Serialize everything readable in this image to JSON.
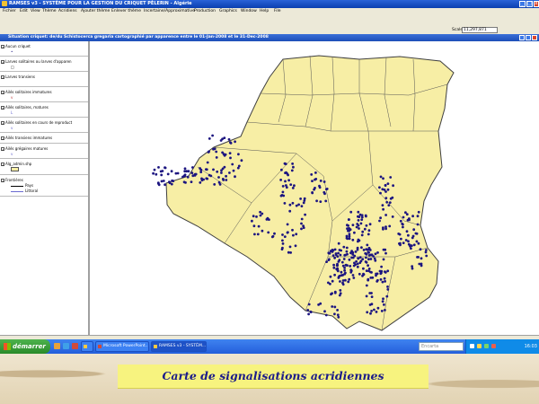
{
  "window": {
    "title": "RAMSES v3 - SYSTÈME POUR LA GESTION DU CRIQUET PÈLERIN - Algérie"
  },
  "menu": [
    "Fichier",
    "Edit",
    "View",
    "Thème",
    "Acridiens",
    "Ajouter thème",
    "Enlever thème",
    "Incertaine/Approximative",
    "Production",
    "Graphics",
    "Window",
    "Help",
    "File"
  ],
  "toolbar": {
    "scale_label": "Scale 1:",
    "scale_value": "11,297,871"
  },
  "view": {
    "title": "Situation criquet: de/du Schistocerca gregaria cartographié par apparence entre le 01-Jan-2008 et le 31-Dec-2008"
  },
  "legend": {
    "layers": [
      {
        "label": "Aucun criquet",
        "checked": true,
        "symbol": "•"
      },
      {
        "label": "Larves solitaires ou larves d'apparen",
        "checked": true,
        "symbol": "□"
      },
      {
        "label": "Larves transiens",
        "checked": true,
        "symbol": ""
      },
      {
        "label": "Ailés solitaires immatures",
        "checked": true,
        "symbol": "v"
      },
      {
        "label": "Ailés solitaires, matures",
        "checked": true,
        "symbol": "L"
      },
      {
        "label": "Ailés solitaires en cours de reproduct",
        "checked": true,
        "symbol": "v"
      },
      {
        "label": "Ailés transiens immatures",
        "checked": true,
        "symbol": ""
      },
      {
        "label": "Ailés grégaires matures",
        "checked": true,
        "symbol": "v"
      },
      {
        "label": "Alg_admin.shp",
        "checked": true,
        "symbol": ""
      },
      {
        "label": "Frontières",
        "checked": true,
        "symbol": ""
      }
    ],
    "frontier_items": [
      "Pays",
      "Littoral"
    ]
  },
  "taskbar": {
    "start_label": "démarrer",
    "tasks": [
      "",
      "Microsoft PowerPoint...",
      "RAMSES v3 - SYSTÈM..."
    ],
    "search_placeholder": "Encarta",
    "clock": "16:03"
  },
  "colors": {
    "map_fill": "#f7eea5",
    "map_border": "#404040",
    "dots": "#1c1580",
    "caption_bg": "#f7f37f",
    "caption_text": "#1b1b8a"
  },
  "caption": "Carte de signalisations acridiennes"
}
